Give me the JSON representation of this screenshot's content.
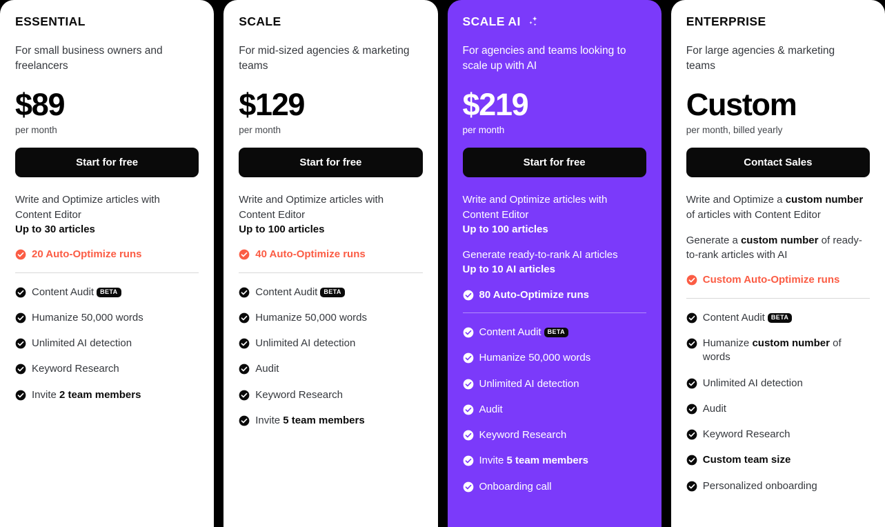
{
  "accent_colors": {
    "highlight_card_bg": "#7B3AFA",
    "runs_red": "#FB5C44",
    "button_black": "#0A0A0A",
    "page_bg": "#000000",
    "card_white": "#FFFFFF"
  },
  "badges": {
    "beta": "BETA"
  },
  "plans": [
    {
      "name": "ESSENTIAL",
      "has_sparkle": false,
      "highlighted": false,
      "description": "For small business owners and freelancers",
      "price": "$89",
      "price_period": "per month",
      "cta_label": "Start for free",
      "blocks": [
        {
          "text_plain": "Write and Optimize articles with Content Editor",
          "text_bold": "Up to 30 articles"
        }
      ],
      "runs_label": "20 Auto-Optimize runs",
      "features": [
        {
          "text": "Content Audit",
          "bold": "",
          "badge": "BETA"
        },
        {
          "text": "Humanize 50,000 words",
          "bold": "",
          "badge": ""
        },
        {
          "text": "Unlimited AI detection",
          "bold": "",
          "badge": ""
        },
        {
          "text": "Keyword Research",
          "bold": "",
          "badge": ""
        },
        {
          "text": "Invite ",
          "bold": "2 team members",
          "badge": ""
        }
      ]
    },
    {
      "name": "SCALE",
      "has_sparkle": false,
      "highlighted": false,
      "description": "For mid-sized agencies & marketing teams",
      "price": "$129",
      "price_period": "per month",
      "cta_label": "Start for free",
      "blocks": [
        {
          "text_plain": "Write and Optimize articles with Content Editor",
          "text_bold": "Up to 100 articles"
        }
      ],
      "runs_label": "40 Auto-Optimize runs",
      "features": [
        {
          "text": "Content Audit",
          "bold": "",
          "badge": "BETA"
        },
        {
          "text": "Humanize 50,000 words",
          "bold": "",
          "badge": ""
        },
        {
          "text": "Unlimited AI detection",
          "bold": "",
          "badge": ""
        },
        {
          "text": "Audit",
          "bold": "",
          "badge": ""
        },
        {
          "text": "Keyword Research",
          "bold": "",
          "badge": ""
        },
        {
          "text": "Invite ",
          "bold": "5 team members",
          "badge": ""
        }
      ]
    },
    {
      "name": "SCALE AI",
      "has_sparkle": true,
      "highlighted": true,
      "description": "For agencies and teams looking to scale up with AI",
      "price": "$219",
      "price_period": "per month",
      "cta_label": "Start for free",
      "blocks": [
        {
          "text_plain": "Write and Optimize articles with Content Editor",
          "text_bold": "Up to 100 articles"
        },
        {
          "text_plain": "Generate ready-to-rank AI articles",
          "text_bold": "Up to 10 AI articles"
        }
      ],
      "runs_label": "80 Auto-Optimize runs",
      "features": [
        {
          "text": "Content Audit",
          "bold": "",
          "badge": "BETA"
        },
        {
          "text": "Humanize 50,000 words",
          "bold": "",
          "badge": ""
        },
        {
          "text": "Unlimited AI detection",
          "bold": "",
          "badge": ""
        },
        {
          "text": "Audit",
          "bold": "",
          "badge": ""
        },
        {
          "text": "Keyword Research",
          "bold": "",
          "badge": ""
        },
        {
          "text": "Invite ",
          "bold": "5 team members",
          "badge": ""
        },
        {
          "text": "Onboarding call",
          "bold": "",
          "badge": ""
        }
      ]
    },
    {
      "name": "ENTERPRISE",
      "has_sparkle": false,
      "highlighted": false,
      "description": "For large agencies & marketing teams",
      "price": "Custom",
      "price_period": "per month, billed yearly",
      "cta_label": "Contact Sales",
      "blocks": [
        {
          "text_plain": "Write and Optimize a |custom number| of articles with Content Editor",
          "text_bold": ""
        },
        {
          "text_plain": "Generate a |custom number| of ready-to-rank articles with AI",
          "text_bold": ""
        }
      ],
      "runs_label": "Custom Auto-Optimize runs",
      "features": [
        {
          "text": "Content Audit",
          "bold": "",
          "badge": "BETA"
        },
        {
          "text": "Humanize |custom number| of words",
          "bold": "",
          "badge": ""
        },
        {
          "text": "Unlimited AI detection",
          "bold": "",
          "badge": ""
        },
        {
          "text": "Audit",
          "bold": "",
          "badge": ""
        },
        {
          "text": "Keyword Research",
          "bold": "",
          "badge": ""
        },
        {
          "text": "",
          "bold": "Custom team size",
          "badge": ""
        },
        {
          "text": "Personalized onboarding",
          "bold": "",
          "badge": ""
        }
      ]
    }
  ]
}
